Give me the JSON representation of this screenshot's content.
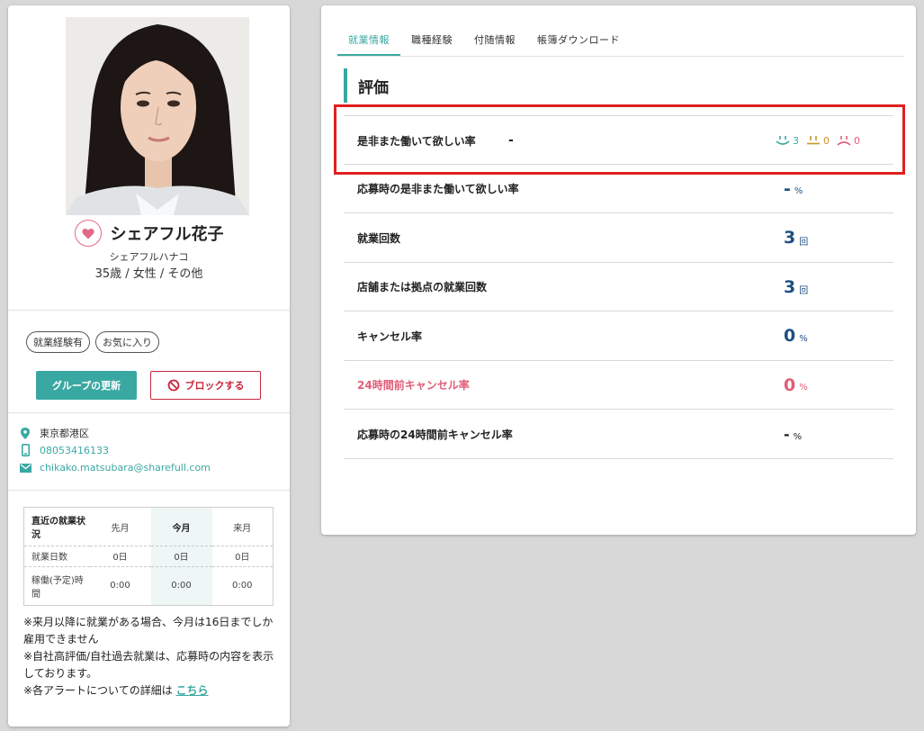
{
  "profile": {
    "name": "シェアフル花子",
    "kana": "シェアフルハナコ",
    "meta": "35歳 / 女性 / その他",
    "tags": [
      "就業経験有",
      "お気に入り"
    ],
    "group_button": "グループの更新",
    "block_button": "ブロックする",
    "address": "東京都港区",
    "phone": "08053416133",
    "email": "chikako.matsubara@sharefull.com"
  },
  "work_status": {
    "header": "直近の就業状況",
    "columns": [
      "先月",
      "今月",
      "来月"
    ],
    "rows": [
      {
        "label": "就業日数",
        "values": [
          "0日",
          "0日",
          "0日"
        ]
      },
      {
        "label": "稼働(予定)時間",
        "values": [
          "0:00",
          "0:00",
          "0:00"
        ]
      }
    ]
  },
  "notes": {
    "line1": "※来月以降に就業がある場合、今月は16日までしか雇用できません",
    "line2": "※自社高評価/自社過去就業は、応募時の内容を表示しております。",
    "line3_prefix": "※各アラートについての詳細は",
    "line3_link": "こちら"
  },
  "tabs": [
    "就業情報",
    "職種経験",
    "付随情報",
    "帳簿ダウンロード"
  ],
  "section_title": "評価",
  "rating": {
    "label": "是非また働いて欲しい率",
    "value": "-",
    "good": "3",
    "neutral": "0",
    "bad": "0"
  },
  "stats": [
    {
      "label": "応募時の是非また働いて欲しい率",
      "value": "-",
      "unit": "%"
    },
    {
      "label": "就業回数",
      "value": "3",
      "unit": "回"
    },
    {
      "label": "店舗または拠点の就業回数",
      "value": "3",
      "unit": "回"
    },
    {
      "label": "キャンセル率",
      "value": "0",
      "unit": "%"
    },
    {
      "label": "24時間前キャンセル率",
      "value": "0",
      "unit": "%"
    },
    {
      "label": "応募時の24時間前キャンセル率",
      "value": "-",
      "unit": "%"
    }
  ],
  "colors": {
    "accent": "#3aa8a2",
    "pink": "#e05d77",
    "navy": "#1f4f83",
    "highlight": "#e02020",
    "block_red": "#c8283c"
  }
}
